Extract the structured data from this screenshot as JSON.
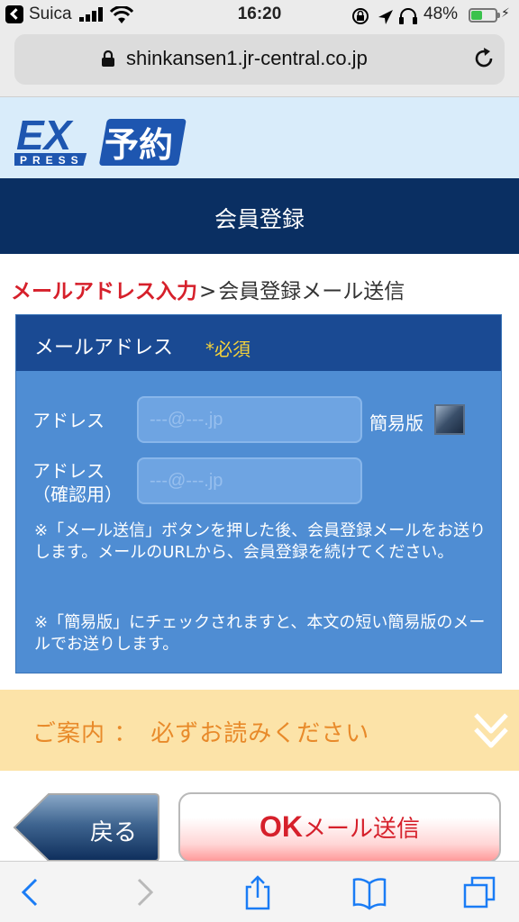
{
  "status_bar": {
    "carrier": "Suica",
    "time": "16:20",
    "battery_percent": "48%",
    "battery_level": 0.48,
    "icons": [
      "back-to-app-icon",
      "signal-icon",
      "wifi-icon",
      "screen-lock-icon",
      "location-icon",
      "headphones-icon",
      "battery-icon",
      "charging-icon"
    ]
  },
  "browser": {
    "url": "shinkansen1.jr-central.co.jp"
  },
  "header": {
    "logo_text": "EX",
    "logo_sub": "PRESS",
    "logo_kanji": "予約",
    "page_title": "会員登録"
  },
  "breadcrumb": {
    "active": "メールアドレス入力",
    "separator": ">",
    "next": "会員登録メール送信"
  },
  "form": {
    "section_title": "メールアドレス",
    "required_label": "*必須",
    "address_label": "アドレス",
    "address_placeholder": "---@---.jp",
    "address_value": "",
    "confirm_label_line1": "アドレス",
    "confirm_label_line2": "（確認用）",
    "confirm_placeholder": "---@---.jp",
    "confirm_value": "",
    "simple_label": "簡易版",
    "note1": "※「メール送信」ボタンを押した後、会員登録メールをお送りします。メールのURLから、会員登録を続けてください。",
    "note2": "※「簡易版」にチェックされますと、本文の短い簡易版のメールでお送りします。"
  },
  "guide": {
    "text": "ご案内 ：　必ずお読みください"
  },
  "buttons": {
    "back_label": "戻る",
    "ok_strong": "OK",
    "ok_rest": "メール送信"
  },
  "colors": {
    "title_bar": "#0a2f62",
    "panel": "#4f8dd3",
    "panel_head": "#1a4a93",
    "accent_red": "#d6202b",
    "required_yellow": "#f5d23a",
    "guide_bg": "#fce3a8",
    "guide_text": "#e88a2a"
  }
}
